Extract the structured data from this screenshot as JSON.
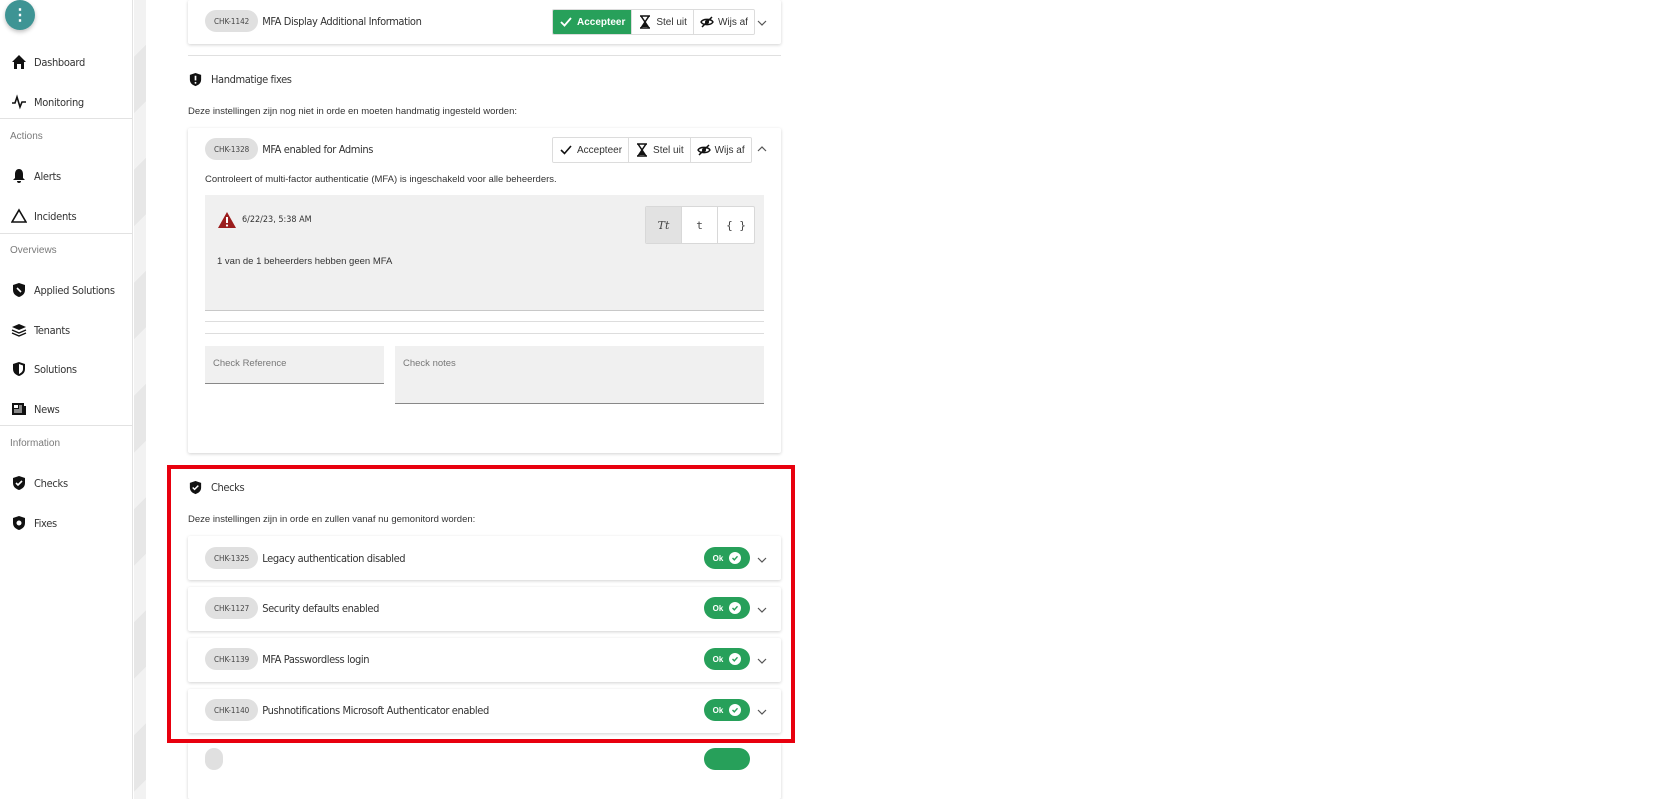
{
  "sidebar": {
    "menu_label": "⋮",
    "items": [
      {
        "label": "Dashboard",
        "icon": "home-icon"
      },
      {
        "label": "Monitoring",
        "icon": "pulse-icon"
      },
      {
        "label": "Alerts",
        "icon": "bell-icon"
      },
      {
        "label": "Incidents",
        "icon": "warning-triangle-icon"
      },
      {
        "label": "Applied Solutions",
        "icon": "shield-wrench-icon"
      },
      {
        "label": "Tenants",
        "icon": "layers-icon"
      },
      {
        "label": "Solutions",
        "icon": "shield-icon"
      },
      {
        "label": "News",
        "icon": "newspaper-icon"
      },
      {
        "label": "Checks",
        "icon": "shield-check-icon"
      },
      {
        "label": "Fixes",
        "icon": "shield-fix-icon"
      }
    ],
    "sections": [
      "Actions",
      "Overviews",
      "Information"
    ]
  },
  "top_row": {
    "code": "CHK-1142",
    "title": "MFA Display Additional Information",
    "accept": "Accepteer",
    "defer": "Stel uit",
    "reject": "Wijs af"
  },
  "manual": {
    "heading": "Handmatige fixes",
    "description": "Deze instellingen zijn nog niet in orde en moeten handmatig ingesteld worden:",
    "row": {
      "code": "CHK-1328",
      "title": "MFA enabled for Admins",
      "accept": "Accepteer",
      "defer": "Stel uit",
      "reject": "Wijs af",
      "description": "Controleert of multi-factor authenticatie (MFA) is ingeschakeld voor alle beheerders.",
      "timestamp": "6/22/23, 5:38 AM",
      "result": "1 van de 1 beheerders hebben geen MFA",
      "formats": [
        "Tt",
        "t",
        "{ }"
      ],
      "reference_placeholder": "Check Reference",
      "notes_placeholder": "Check notes"
    }
  },
  "checks": {
    "heading": "Checks",
    "description": "Deze instellingen zijn in orde en zullen vanaf nu gemonitord worden:",
    "ok_label": "Ok",
    "items": [
      {
        "code": "CHK-1325",
        "title": "Legacy authentication disabled"
      },
      {
        "code": "CHK-1127",
        "title": "Security defaults enabled"
      },
      {
        "code": "CHK-1139",
        "title": "MFA Passwordless login"
      },
      {
        "code": "CHK-1140",
        "title": "Pushnotifications Microsoft Authenticator enabled"
      }
    ]
  },
  "colors": {
    "accent": "#3e9494",
    "success": "#27a05a",
    "highlight": "#e8000e",
    "warning": "#9b1c1c"
  }
}
